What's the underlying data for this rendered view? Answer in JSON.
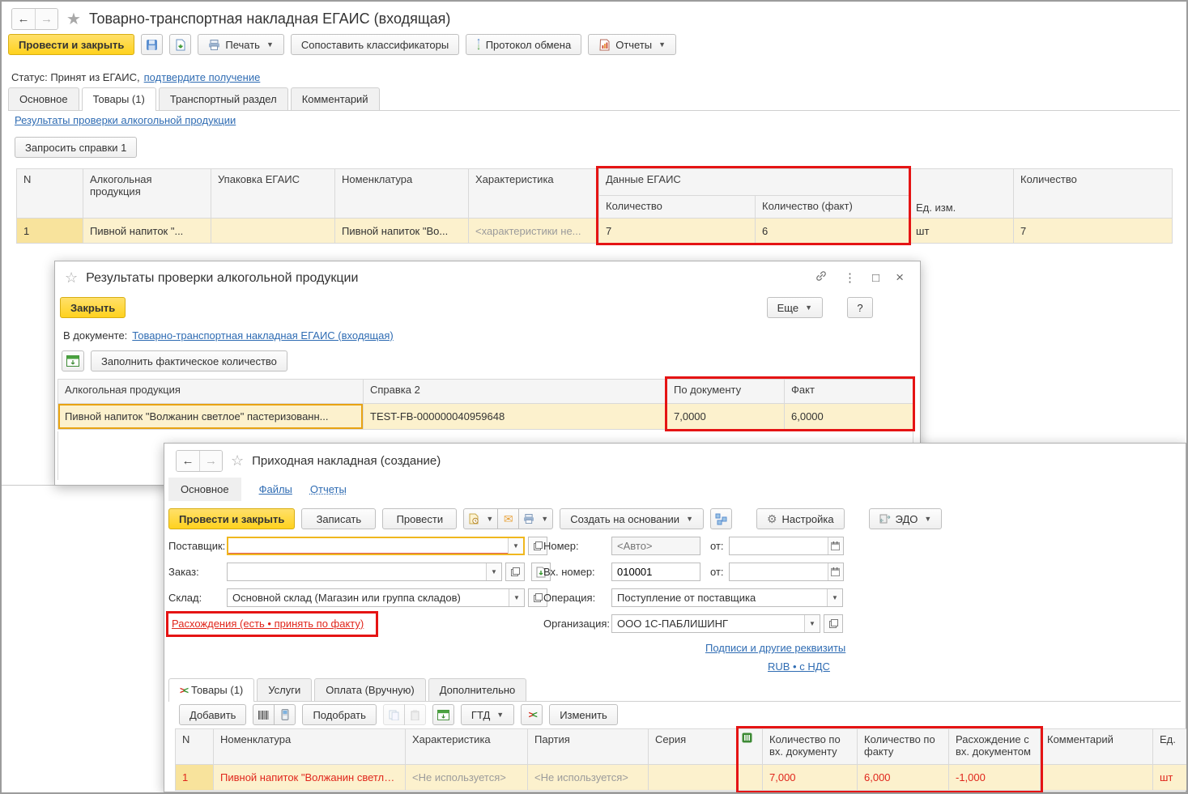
{
  "egais_window": {
    "title": "Товарно-транспортная накладная ЕГАИС (входящая)",
    "toolbar": {
      "post_close": "Провести и закрыть",
      "print": "Печать",
      "match_classifiers": "Сопоставить классификаторы",
      "exchange_protocol": "Протокол обмена",
      "reports": "Отчеты"
    },
    "status": {
      "label": "Статус: Принят из ЕГАИС,",
      "link": "подтвердите получение"
    },
    "tabs": [
      {
        "label": "Основное"
      },
      {
        "label": "Товары (1)"
      },
      {
        "label": "Транспортный раздел"
      },
      {
        "label": "Комментарий"
      }
    ],
    "results_link": "Результаты проверки алкогольной продукции",
    "request_certs_button": "Запросить справки 1",
    "goods_table": {
      "group_header": "Данные ЕГАИС",
      "headers": {
        "n": "N",
        "alco": "Алкогольная продукция",
        "pack": "Упаковка ЕГАИС",
        "nomenclature": "Номенклатура",
        "characteristic": "Характеристика",
        "qty": "Количество",
        "qty_fact": "Количество (факт)",
        "unit": "Ед. изм.",
        "quantity": "Количество"
      },
      "row": {
        "n": "1",
        "alco": "Пивной напиток \"...",
        "pack": "",
        "nomenclature": "Пивной напиток \"Во...",
        "characteristic": "<характеристики не...",
        "qty": "7",
        "qty_fact": "6",
        "unit": "шт",
        "quantity": "7"
      }
    }
  },
  "results_dialog": {
    "title": "Результаты проверки алкогольной продукции",
    "close_button": "Закрыть",
    "more_button": "Еще",
    "help_button": "?",
    "in_document_label": "В документе:",
    "in_document_link": "Товарно-транспортная накладная ЕГАИС (входящая)",
    "fill_fact_button": "Заполнить фактическое количество",
    "table": {
      "headers": {
        "alco": "Алкогольная продукция",
        "cert2": "Справка 2",
        "by_doc": "По документу",
        "fact": "Факт"
      },
      "row": {
        "alco": "Пивной напиток \"Волжанин светлое\" пастеризованн...",
        "cert2": "TEST-FB-000000040959648",
        "by_doc": "7,0000",
        "fact": "6,0000"
      }
    }
  },
  "invoice_window": {
    "title": "Приходная накладная (создание)",
    "nav_tabs": {
      "main": "Основное",
      "files": "Файлы",
      "reports": "Отчеты"
    },
    "toolbar": {
      "post_close": "Провести и закрыть",
      "save": "Записать",
      "post": "Провести",
      "create_based": "Создать на основании",
      "settings": "Настройка",
      "edo": "ЭДО"
    },
    "fields": {
      "supplier_label": "Поставщик:",
      "order_label": "Заказ:",
      "warehouse_label": "Склад:",
      "warehouse_value": "Основной склад (Магазин или группа складов)",
      "discrepancy_link": "Расхождения (есть • принять по факту)",
      "number_label": "Номер:",
      "number_placeholder": "<Авто>",
      "from_label": "от:",
      "in_number_label": "Вх. номер:",
      "in_number_value": "010001",
      "operation_label": "Операция:",
      "operation_value": "Поступление от поставщика",
      "org_label": "Организация:",
      "org_value": "ООО 1С-ПАБЛИШИНГ",
      "signatures_link": "Подписи и другие реквизиты",
      "currency_link": "RUB • с НДС"
    },
    "detail_tabs": [
      {
        "label": "Товары (1)"
      },
      {
        "label": "Услуги"
      },
      {
        "label": "Оплата (Вручную)"
      },
      {
        "label": "Дополнительно"
      }
    ],
    "detail_toolbar": {
      "add": "Добавить",
      "pick": "Подобрать",
      "gtd": "ГТД",
      "edit": "Изменить"
    },
    "goods_table": {
      "headers": {
        "n": "N",
        "nomenclature": "Номенклатура",
        "characteristic": "Характеристика",
        "batch": "Партия",
        "series": "Серия",
        "qty_doc": "Количество по вх. документу",
        "qty_fact": "Количество по факту",
        "diff": "Расхождение с вх. документом",
        "comment": "Комментарий",
        "unit": "Ед."
      },
      "row": {
        "n": "1",
        "nomenclature": "Пивной напиток \"Волжанин светло...",
        "characteristic": "<Не используется>",
        "batch": "<Не используется>",
        "series": "",
        "qty_doc": "7,000",
        "qty_fact": "6,000",
        "diff": "-1,000",
        "comment": "",
        "unit": "шт"
      }
    }
  },
  "colors": {
    "accent_yellow": "#ffd21e",
    "row_highlight": "#fcf1cd",
    "red_box": "#e51414",
    "red_text": "#e0261c",
    "link_blue": "#2f6cb3"
  }
}
